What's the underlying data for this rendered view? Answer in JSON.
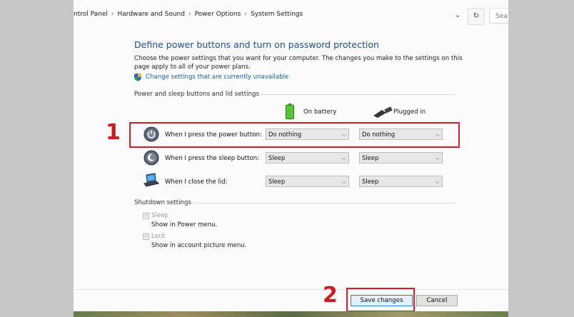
{
  "breadcrumb": [
    "ntrol Panel",
    "Hardware and Sound",
    "Power Options",
    "System Settings"
  ],
  "search": {
    "placeholder": "Sea"
  },
  "page": {
    "title": "Define power buttons and turn on password protection",
    "description": "Choose the power settings that you want for your computer. The changes you make to the settings on this page apply to all of your power plans.",
    "change_settings_link": "Change settings that are currently unavailable",
    "section_title": "Power and sleep buttons and lid settings",
    "columns": {
      "on_battery": "On battery",
      "plugged_in": "Plugged in"
    }
  },
  "rows": [
    {
      "label": "When I press the power button:",
      "on_battery": "Do nothing",
      "plugged_in": "Do nothing"
    },
    {
      "label": "When I press the sleep button:",
      "on_battery": "Sleep",
      "plugged_in": "Sleep"
    },
    {
      "label": "When I close the lid:",
      "on_battery": "Sleep",
      "plugged_in": "Sleep"
    }
  ],
  "shutdown": {
    "title": "Shutdown settings",
    "items": [
      {
        "label": "Sleep",
        "description": "Show in Power menu.",
        "checked": true
      },
      {
        "label": "Lock",
        "description": "Show in account picture menu.",
        "checked": true
      }
    ]
  },
  "buttons": {
    "save": "Save changes",
    "cancel": "Cancel"
  },
  "annotations": {
    "step1": "1",
    "step2": "2"
  },
  "colors": {
    "highlight": "#d0202b",
    "link": "#1a5fb4",
    "title": "#1f4e8c"
  }
}
